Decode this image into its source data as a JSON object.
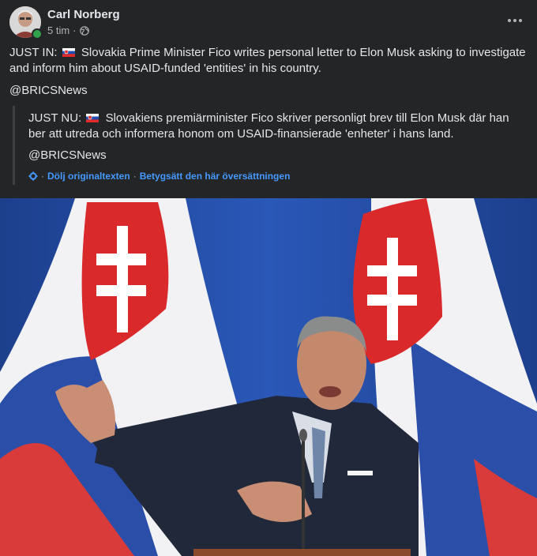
{
  "post": {
    "author": "Carl Norberg",
    "time": "5 tim",
    "separator": "·",
    "text_prefix": "JUST IN:",
    "text_body": "Slovakia Prime Minister Fico writes personal letter to Elon Musk asking to investigate and inform him about USAID-funded 'entities' in his country.",
    "mention": "@BRICSNews"
  },
  "translation": {
    "text_prefix": "JUST NU:",
    "text_body": "Slovakiens premiärminister Fico skriver personligt brev till Elon Musk där han ber att utreda och informera honom om USAID-finansierade 'enheter' i hans land.",
    "mention": "@BRICSNews",
    "hide_link": "Dölj originaltexten",
    "rate_link": "Betygsätt den här översättningen",
    "dot": "·"
  },
  "icons": {
    "audience": "globe-icon",
    "more": "more-horizontal-icon",
    "translate": "gear-icon",
    "flag": "slovakia-flag-icon"
  },
  "colors": {
    "background": "#242526",
    "text": "#e4e6eb",
    "secondary_text": "#b0b3b8",
    "link": "#4599ff",
    "online": "#31a24c"
  }
}
